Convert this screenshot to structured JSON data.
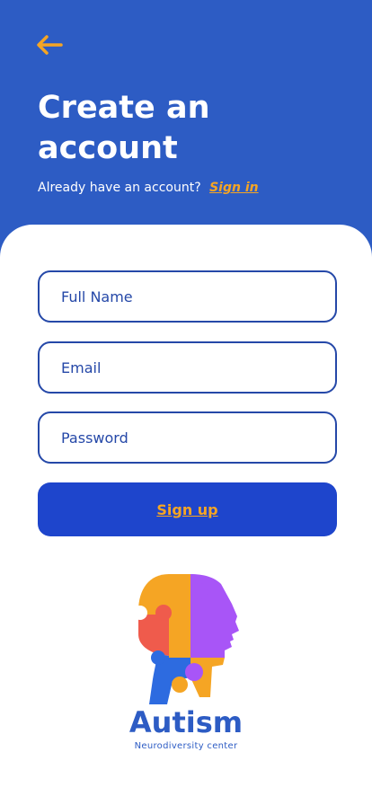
{
  "header": {
    "back_icon": "arrow-left-icon",
    "title": "Create an account",
    "signin_prompt": "Already have an account?",
    "signin_link": "Sign in"
  },
  "form": {
    "full_name_placeholder": "Full Name",
    "email_placeholder": "Email",
    "password_placeholder": "Password",
    "signup_label": "Sign up"
  },
  "brand": {
    "name": "Autism",
    "tagline": "Neurodiversity center",
    "logo_icon": "puzzle-head-icon"
  },
  "colors": {
    "primary": "#2d5cc4",
    "accent": "#f5a524",
    "button": "#1e45cc",
    "field_border": "#2548a8",
    "puzzle_purple": "#a855f7",
    "puzzle_red": "#ef5b4c"
  }
}
